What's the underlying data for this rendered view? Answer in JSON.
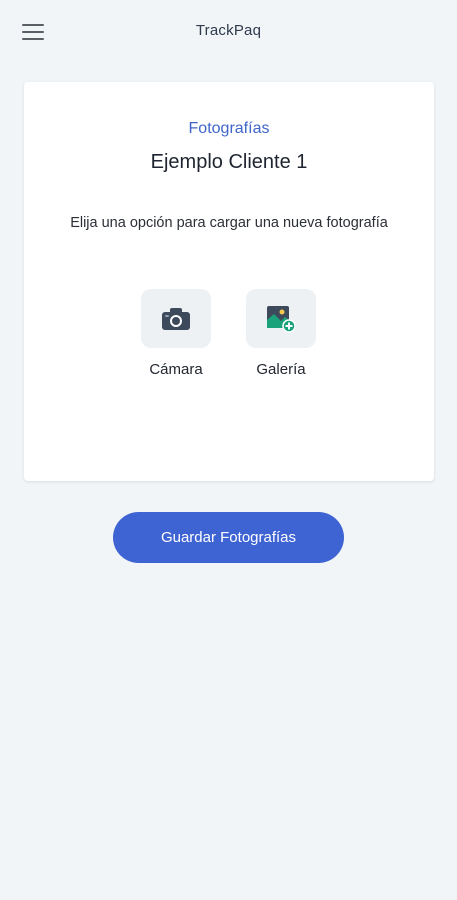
{
  "app": {
    "title": "TrackPaq"
  },
  "card": {
    "subtitle": "Fotografías",
    "title": "Ejemplo Cliente 1",
    "instruction": "Elija una opción para cargar una nueva fotografía",
    "options": [
      {
        "label": "Cámara",
        "icon": "camera-icon"
      },
      {
        "label": "Galería",
        "icon": "gallery-add-icon"
      }
    ]
  },
  "actions": {
    "save_label": "Guardar Fotografías"
  },
  "colors": {
    "background": "#f1f5f7",
    "accent": "#3e63d3",
    "subtitle": "#3f66c8",
    "camera_icon": "#3d4a5c",
    "gallery_icon": "#1aa37a"
  }
}
